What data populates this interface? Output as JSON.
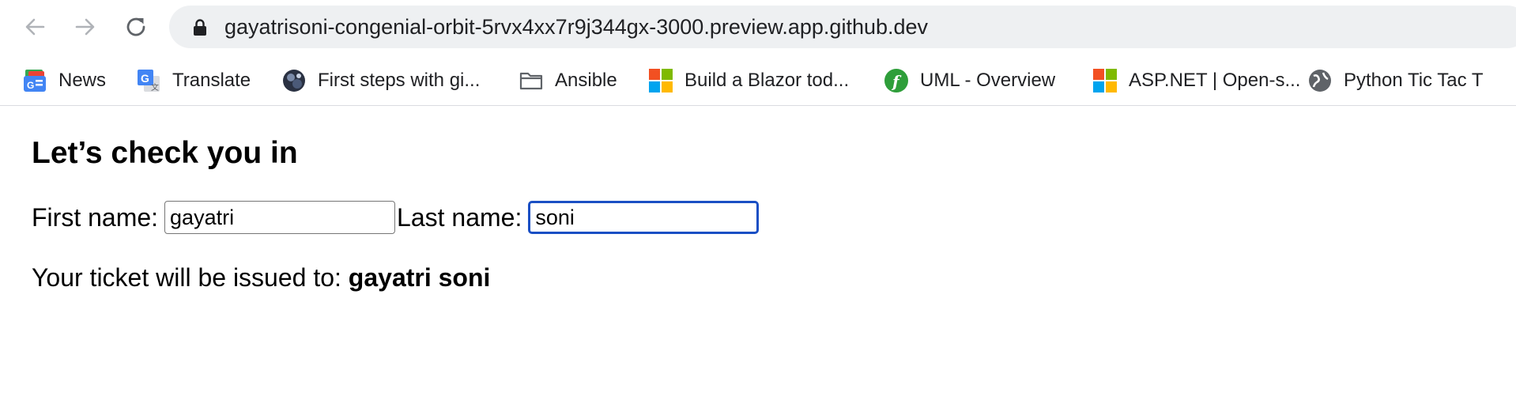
{
  "browser": {
    "url": "gayatrisoni-congenial-orbit-5rvx4xx7r9j344gx-3000.preview.app.github.dev",
    "bookmarks": [
      {
        "label": "News",
        "icon": "google-news-icon"
      },
      {
        "label": "Translate",
        "icon": "google-translate-icon"
      },
      {
        "label": "First steps with gi...",
        "icon": "globe-photo-icon"
      },
      {
        "label": "Ansible",
        "icon": "folder-icon"
      },
      {
        "label": "Build a Blazor tod...",
        "icon": "microsoft-logo-icon"
      },
      {
        "label": "UML - Overview",
        "icon": "uml-site-icon"
      },
      {
        "label": "ASP.NET | Open-s...",
        "icon": "microsoft-logo-icon"
      },
      {
        "label": "Python Tic Tac T",
        "icon": "globe-icon"
      }
    ]
  },
  "page": {
    "title": "Let’s check you in",
    "first_name_label": "First name:",
    "first_name_value": "gayatri",
    "last_name_label": "Last name:",
    "last_name_value": "soni",
    "ticket_prefix": "Your ticket will be issued to:",
    "ticket_name": "gayatri soni"
  },
  "colors": {
    "focus_ring": "#1a4fc4",
    "omnibox_bg": "#eef0f2"
  }
}
